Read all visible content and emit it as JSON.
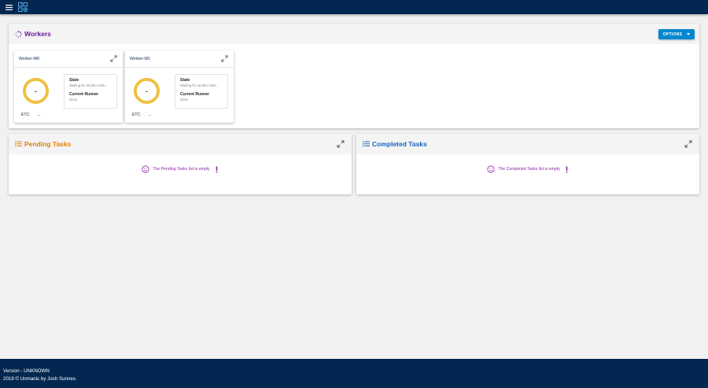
{
  "workers": {
    "title": "Workers",
    "options_label": "OPTIONS",
    "cards": [
      {
        "name": "Worker-W0",
        "gauge_value": "-",
        "state_label": "State",
        "state_value": "Waiting for another task...",
        "runner_label": "Current Runner",
        "runner_value": "None",
        "etc_label": "ETC:",
        "etc_value": "..."
      },
      {
        "name": "Worker-W1",
        "gauge_value": "-",
        "state_label": "State",
        "state_value": "Waiting for another task...",
        "runner_label": "Current Runner",
        "runner_value": "None",
        "etc_label": "ETC:",
        "etc_value": "..."
      }
    ]
  },
  "pending": {
    "title": "Pending Tasks",
    "empty_message": "The Pending Tasks list is empty"
  },
  "completed": {
    "title": "Completed Tasks",
    "empty_message": "The Completed Tasks list is empty"
  },
  "footer": {
    "version": "Version - UNKNOWN",
    "copyright": "2018 © Unmanic by Josh Sunnex."
  },
  "colors": {
    "header_bg": "#022851",
    "workers_title": "#6a1b9a",
    "pending_title": "#e67e00",
    "completed_title": "#1565c0",
    "accent_button": "#0288d1",
    "empty_message": "#8e24aa",
    "gauge_ring": "#f0c040"
  },
  "icons": {
    "menu": "menu-icon",
    "logo": "app-logo-icon",
    "workers": "spinner-icon",
    "tasks": "list-icon",
    "expand": "expand-icon",
    "empty": "sad-face-icon",
    "alert": "exclamation-icon"
  }
}
